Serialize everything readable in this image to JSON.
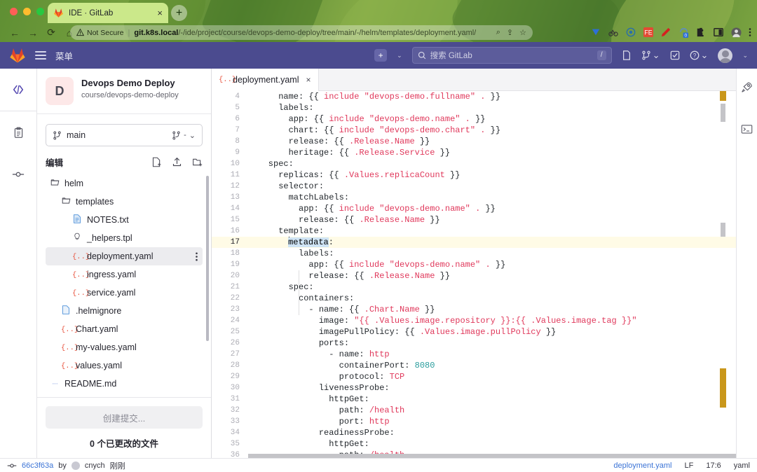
{
  "browser": {
    "tab": {
      "title": "IDE · GitLab",
      "favicon": "gitlab-fox-icon",
      "close": "×"
    },
    "new_tab_label": "+",
    "nav": {
      "back": "←",
      "forward": "→",
      "reload": "⟳",
      "home": "⌂"
    },
    "omnibox": {
      "security_label": "Not Secure",
      "url_host": "git.k8s.local",
      "url_path": "/-/ide/project/course/devops-demo-deploy/tree/main/-/helm/templates/deployment.yaml/"
    },
    "extensions": [
      "zoom-icon",
      "share-icon",
      "bookmark-star-icon",
      "v-shield-icon",
      "cycling-icon",
      "target-icon",
      "fe-icon",
      "pen-icon",
      "sync-badge-icon",
      "puzzle-extension-icon",
      "sidepanel-icon",
      "profile-avatar-icon",
      "kebab-menu-icon"
    ],
    "sync_badge": "0"
  },
  "gitlab_header": {
    "logo": "gitlab-logo-icon",
    "menu_label": "菜单",
    "search_placeholder": "搜索 GitLab",
    "search_shortcut": "/",
    "plus_label": "+",
    "icons": [
      "new-item-icon",
      "merge-requests-icon",
      "todos-icon",
      "help-icon",
      "user-avatar"
    ]
  },
  "sidebar": {
    "rail": [
      {
        "name": "edit-code",
        "icon": "code-brackets-icon",
        "active": true
      },
      {
        "name": "review",
        "icon": "clipboard-icon",
        "active": false
      },
      {
        "name": "commit",
        "icon": "commit-node-icon",
        "active": false
      }
    ],
    "project": {
      "avatar_letter": "D",
      "name": "Devops Demo Deploy",
      "path": "course/devops-demo-deploy"
    },
    "branch": {
      "icon": "branch-icon",
      "name": "main",
      "merge_icon": "merge-request-icon",
      "dash": "-",
      "caret": "⌄"
    },
    "edit_section": {
      "label": "编辑",
      "actions": [
        "new-file-icon",
        "upload-file-icon",
        "new-folder-icon"
      ]
    },
    "tree": [
      {
        "label": "helm",
        "icon": "folder-open-icon",
        "indent": 0,
        "selected": false
      },
      {
        "label": "templates",
        "icon": "folder-open-icon",
        "indent": 1,
        "selected": false
      },
      {
        "label": "NOTES.txt",
        "icon": "text-file-icon",
        "indent": 2,
        "selected": false
      },
      {
        "label": "_helpers.tpl",
        "icon": "template-file-icon",
        "indent": 2,
        "selected": false
      },
      {
        "label": "deployment.yaml",
        "icon": "yaml-file-icon",
        "indent": 2,
        "selected": true,
        "kebab": "⋮"
      },
      {
        "label": "ingress.yaml",
        "icon": "yaml-file-icon",
        "indent": 2,
        "selected": false
      },
      {
        "label": "service.yaml",
        "icon": "yaml-file-icon",
        "indent": 2,
        "selected": false
      },
      {
        "label": ".helmignore",
        "icon": "plain-file-icon",
        "indent": 1,
        "selected": false
      },
      {
        "label": "Chart.yaml",
        "icon": "yaml-file-icon",
        "indent": 1,
        "selected": false
      },
      {
        "label": "my-values.yaml",
        "icon": "yaml-file-icon",
        "indent": 1,
        "selected": false
      },
      {
        "label": "values.yaml",
        "icon": "yaml-file-icon",
        "indent": 1,
        "selected": false
      },
      {
        "label": "README.md",
        "icon": "markdown-file-icon",
        "indent": 0,
        "selected": false
      }
    ],
    "commit_button": "创建提交...",
    "changed_files": "0 个已更改的文件"
  },
  "editor": {
    "tab": {
      "icon": "yaml-file-icon",
      "label": "deployment.yaml",
      "close": "×"
    },
    "right_rail": [
      "rocket-icon",
      "terminal-icon"
    ],
    "first_line_number": 4,
    "active_line": 17,
    "lines": [
      {
        "n": 4,
        "tokens": [
          {
            "t": "      name: ",
            "c": "k"
          },
          {
            "t": "{{ ",
            "c": "p"
          },
          {
            "t": "include \"devops-demo.fullname\" .",
            "c": "s"
          },
          {
            "t": " }}",
            "c": "p"
          }
        ]
      },
      {
        "n": 5,
        "tokens": [
          {
            "t": "      labels:",
            "c": "k"
          }
        ]
      },
      {
        "n": 6,
        "tokens": [
          {
            "t": "        app: ",
            "c": "k"
          },
          {
            "t": "{{ ",
            "c": "p"
          },
          {
            "t": "include \"devops-demo.name\" .",
            "c": "s"
          },
          {
            "t": " }}",
            "c": "p"
          }
        ]
      },
      {
        "n": 7,
        "tokens": [
          {
            "t": "        chart: ",
            "c": "k"
          },
          {
            "t": "{{ ",
            "c": "p"
          },
          {
            "t": "include \"devops-demo.chart\" .",
            "c": "s"
          },
          {
            "t": " }}",
            "c": "p"
          }
        ]
      },
      {
        "n": 8,
        "tokens": [
          {
            "t": "        release: ",
            "c": "k"
          },
          {
            "t": "{{ ",
            "c": "p"
          },
          {
            "t": ".Release.Name",
            "c": "s"
          },
          {
            "t": " }}",
            "c": "p"
          }
        ]
      },
      {
        "n": 9,
        "tokens": [
          {
            "t": "        heritage: ",
            "c": "k"
          },
          {
            "t": "{{ ",
            "c": "p"
          },
          {
            "t": ".Release.Service",
            "c": "s"
          },
          {
            "t": " }}",
            "c": "p"
          }
        ]
      },
      {
        "n": 10,
        "tokens": [
          {
            "t": "    spec:",
            "c": "k"
          }
        ]
      },
      {
        "n": 11,
        "tokens": [
          {
            "t": "      replicas: ",
            "c": "k"
          },
          {
            "t": "{{ ",
            "c": "p"
          },
          {
            "t": ".Values.replicaCount",
            "c": "s"
          },
          {
            "t": " }}",
            "c": "p"
          }
        ]
      },
      {
        "n": 12,
        "tokens": [
          {
            "t": "      selector:",
            "c": "k"
          }
        ]
      },
      {
        "n": 13,
        "tokens": [
          {
            "t": "        matchLabels:",
            "c": "k"
          }
        ]
      },
      {
        "n": 14,
        "tokens": [
          {
            "t": "          app: ",
            "c": "k"
          },
          {
            "t": "{{ ",
            "c": "p"
          },
          {
            "t": "include \"devops-demo.name\" .",
            "c": "s"
          },
          {
            "t": " }}",
            "c": "p"
          }
        ]
      },
      {
        "n": 15,
        "tokens": [
          {
            "t": "          release: ",
            "c": "k"
          },
          {
            "t": "{{ ",
            "c": "p"
          },
          {
            "t": ".Release.Name",
            "c": "s"
          },
          {
            "t": " }}",
            "c": "p"
          }
        ]
      },
      {
        "n": 16,
        "tokens": [
          {
            "t": "      template:",
            "c": "k"
          }
        ]
      },
      {
        "n": 17,
        "tokens": [
          {
            "t": "        ",
            "c": "k"
          },
          {
            "t": "metadata",
            "c": "sel"
          },
          {
            "t": ":",
            "c": "k"
          }
        ],
        "active": true,
        "caret_after": 8
      },
      {
        "n": 18,
        "tokens": [
          {
            "t": "          labels:",
            "c": "k"
          }
        ]
      },
      {
        "n": 19,
        "tokens": [
          {
            "t": "            app: ",
            "c": "k"
          },
          {
            "t": "{{ ",
            "c": "p"
          },
          {
            "t": "include \"devops-demo.name\" .",
            "c": "s"
          },
          {
            "t": " }}",
            "c": "p"
          }
        ]
      },
      {
        "n": 20,
        "tokens": [
          {
            "t": "            release: ",
            "c": "k"
          },
          {
            "t": "{{ ",
            "c": "p"
          },
          {
            "t": ".Release.Name",
            "c": "s"
          },
          {
            "t": " }}",
            "c": "p"
          }
        ]
      },
      {
        "n": 21,
        "tokens": [
          {
            "t": "        spec:",
            "c": "k"
          }
        ]
      },
      {
        "n": 22,
        "tokens": [
          {
            "t": "          containers:",
            "c": "k"
          }
        ]
      },
      {
        "n": 23,
        "tokens": [
          {
            "t": "            - name: ",
            "c": "k"
          },
          {
            "t": "{{ ",
            "c": "p"
          },
          {
            "t": ".Chart.Name",
            "c": "s"
          },
          {
            "t": " }}",
            "c": "p"
          }
        ]
      },
      {
        "n": 24,
        "tokens": [
          {
            "t": "              image: ",
            "c": "k"
          },
          {
            "t": "\"{{ ",
            "c": "s"
          },
          {
            "t": ".Values.image.repository",
            "c": "s"
          },
          {
            "t": " }}:{{ ",
            "c": "s"
          },
          {
            "t": ".Values.image.tag",
            "c": "s"
          },
          {
            "t": " }}\"",
            "c": "s"
          }
        ]
      },
      {
        "n": 25,
        "tokens": [
          {
            "t": "              imagePullPolicy: ",
            "c": "k"
          },
          {
            "t": "{{ ",
            "c": "p"
          },
          {
            "t": ".Values.image.pullPolicy",
            "c": "s"
          },
          {
            "t": " }}",
            "c": "p"
          }
        ]
      },
      {
        "n": 26,
        "tokens": [
          {
            "t": "              ports:",
            "c": "k"
          }
        ]
      },
      {
        "n": 27,
        "tokens": [
          {
            "t": "                - name: ",
            "c": "k"
          },
          {
            "t": "http",
            "c": "s"
          }
        ]
      },
      {
        "n": 28,
        "tokens": [
          {
            "t": "                  containerPort: ",
            "c": "k"
          },
          {
            "t": "8080",
            "c": "n"
          }
        ]
      },
      {
        "n": 29,
        "tokens": [
          {
            "t": "                  protocol: ",
            "c": "k"
          },
          {
            "t": "TCP",
            "c": "s"
          }
        ]
      },
      {
        "n": 30,
        "tokens": [
          {
            "t": "              livenessProbe:",
            "c": "k"
          }
        ]
      },
      {
        "n": 31,
        "tokens": [
          {
            "t": "                httpGet:",
            "c": "k"
          }
        ]
      },
      {
        "n": 32,
        "tokens": [
          {
            "t": "                  path: ",
            "c": "k"
          },
          {
            "t": "/health",
            "c": "s"
          }
        ]
      },
      {
        "n": 33,
        "tokens": [
          {
            "t": "                  port: ",
            "c": "k"
          },
          {
            "t": "http",
            "c": "s"
          }
        ]
      },
      {
        "n": 34,
        "tokens": [
          {
            "t": "              readinessProbe:",
            "c": "k"
          }
        ]
      },
      {
        "n": 35,
        "tokens": [
          {
            "t": "                httpGet:",
            "c": "k"
          }
        ]
      },
      {
        "n": 36,
        "tokens": [
          {
            "t": "                  path: ",
            "c": "k"
          },
          {
            "t": "/health",
            "c": "s"
          }
        ]
      }
    ]
  },
  "statusbar": {
    "commit_icon": "commit-node-icon",
    "commit_sha": "66c3f63a",
    "by": "by",
    "author": "cnych",
    "time": "刚刚",
    "file": "deployment.yaml",
    "eol": "LF",
    "cursor": "17:6",
    "language": "yaml"
  },
  "colors": {
    "gitlab_purple": "#4b4b8f",
    "accent_blue": "#3c74d6",
    "yaml_string": "#e0385b",
    "yaml_number": "#2a9d9d",
    "browser_green": "#76a03f"
  }
}
